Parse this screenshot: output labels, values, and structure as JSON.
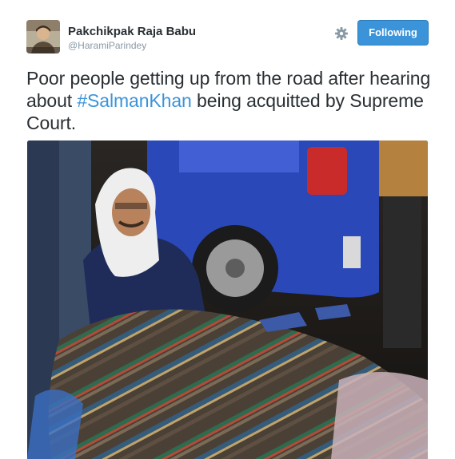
{
  "author": {
    "name": "Pakchikpak Raja Babu",
    "handle": "@HaramiParindey"
  },
  "actions": {
    "follow_label": "Following"
  },
  "tweet": {
    "text_before": "Poor people getting up from the road after hearing about ",
    "hashtag": "#SalmanKhan",
    "text_after": " being acquitted by Supreme Court."
  },
  "icons": {
    "settings": "gear-icon"
  },
  "colors": {
    "accent": "#3b94d9",
    "text": "#292f33",
    "muted": "#8899a6"
  }
}
